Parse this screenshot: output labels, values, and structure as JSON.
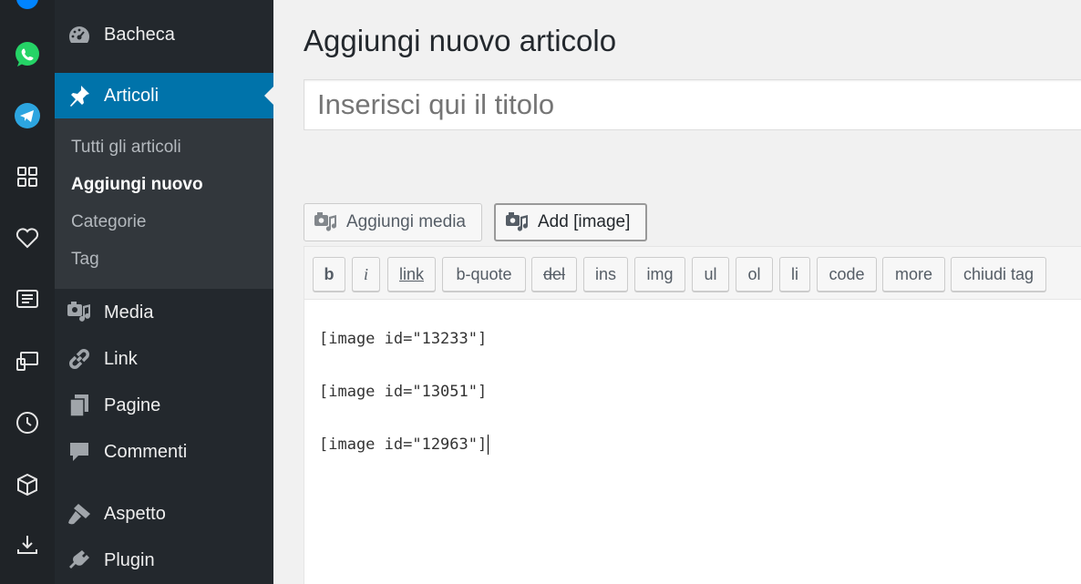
{
  "rail": {
    "icons": [
      "messenger-icon",
      "whatsapp-icon",
      "telegram-icon",
      "apps-grid-icon",
      "heart-icon",
      "news-icon",
      "devices-icon",
      "clock-icon",
      "box-icon",
      "download-icon"
    ],
    "colors": {
      "whatsapp": "#25d366",
      "telegram": "#2ca5e0",
      "messenger": "#0084ff"
    }
  },
  "admin_menu": {
    "items": [
      {
        "label": "Bacheca",
        "icon": "dashboard-icon"
      },
      {
        "label": "Articoli",
        "icon": "pin-icon",
        "current": true
      },
      {
        "label": "Media",
        "icon": "media-icon"
      },
      {
        "label": "Link",
        "icon": "link-icon"
      },
      {
        "label": "Pagine",
        "icon": "pages-icon"
      },
      {
        "label": "Commenti",
        "icon": "comment-icon"
      },
      {
        "label": "Aspetto",
        "icon": "brush-icon"
      },
      {
        "label": "Plugin",
        "icon": "plugin-icon"
      }
    ],
    "submenu": [
      {
        "label": "Tutti gli articoli"
      },
      {
        "label": "Aggiungi nuovo",
        "current": true
      },
      {
        "label": "Categorie"
      },
      {
        "label": "Tag"
      }
    ],
    "colors": {
      "bg": "#23282d",
      "current": "#0073aa",
      "submenu_bg": "#32373c"
    }
  },
  "editor": {
    "page_title": "Aggiungi nuovo articolo",
    "title_placeholder": "Inserisci qui il titolo",
    "media_button": "Aggiungi media",
    "image_button": "Add [image]",
    "quicktags": [
      "b",
      "i",
      "link",
      "b-quote",
      "del",
      "ins",
      "img",
      "ul",
      "ol",
      "li",
      "code",
      "more",
      "chiudi tag"
    ],
    "content_lines": [
      "[image id=\"13233\"]",
      "[image id=\"13051\"]",
      "[image id=\"12963\"]"
    ]
  }
}
